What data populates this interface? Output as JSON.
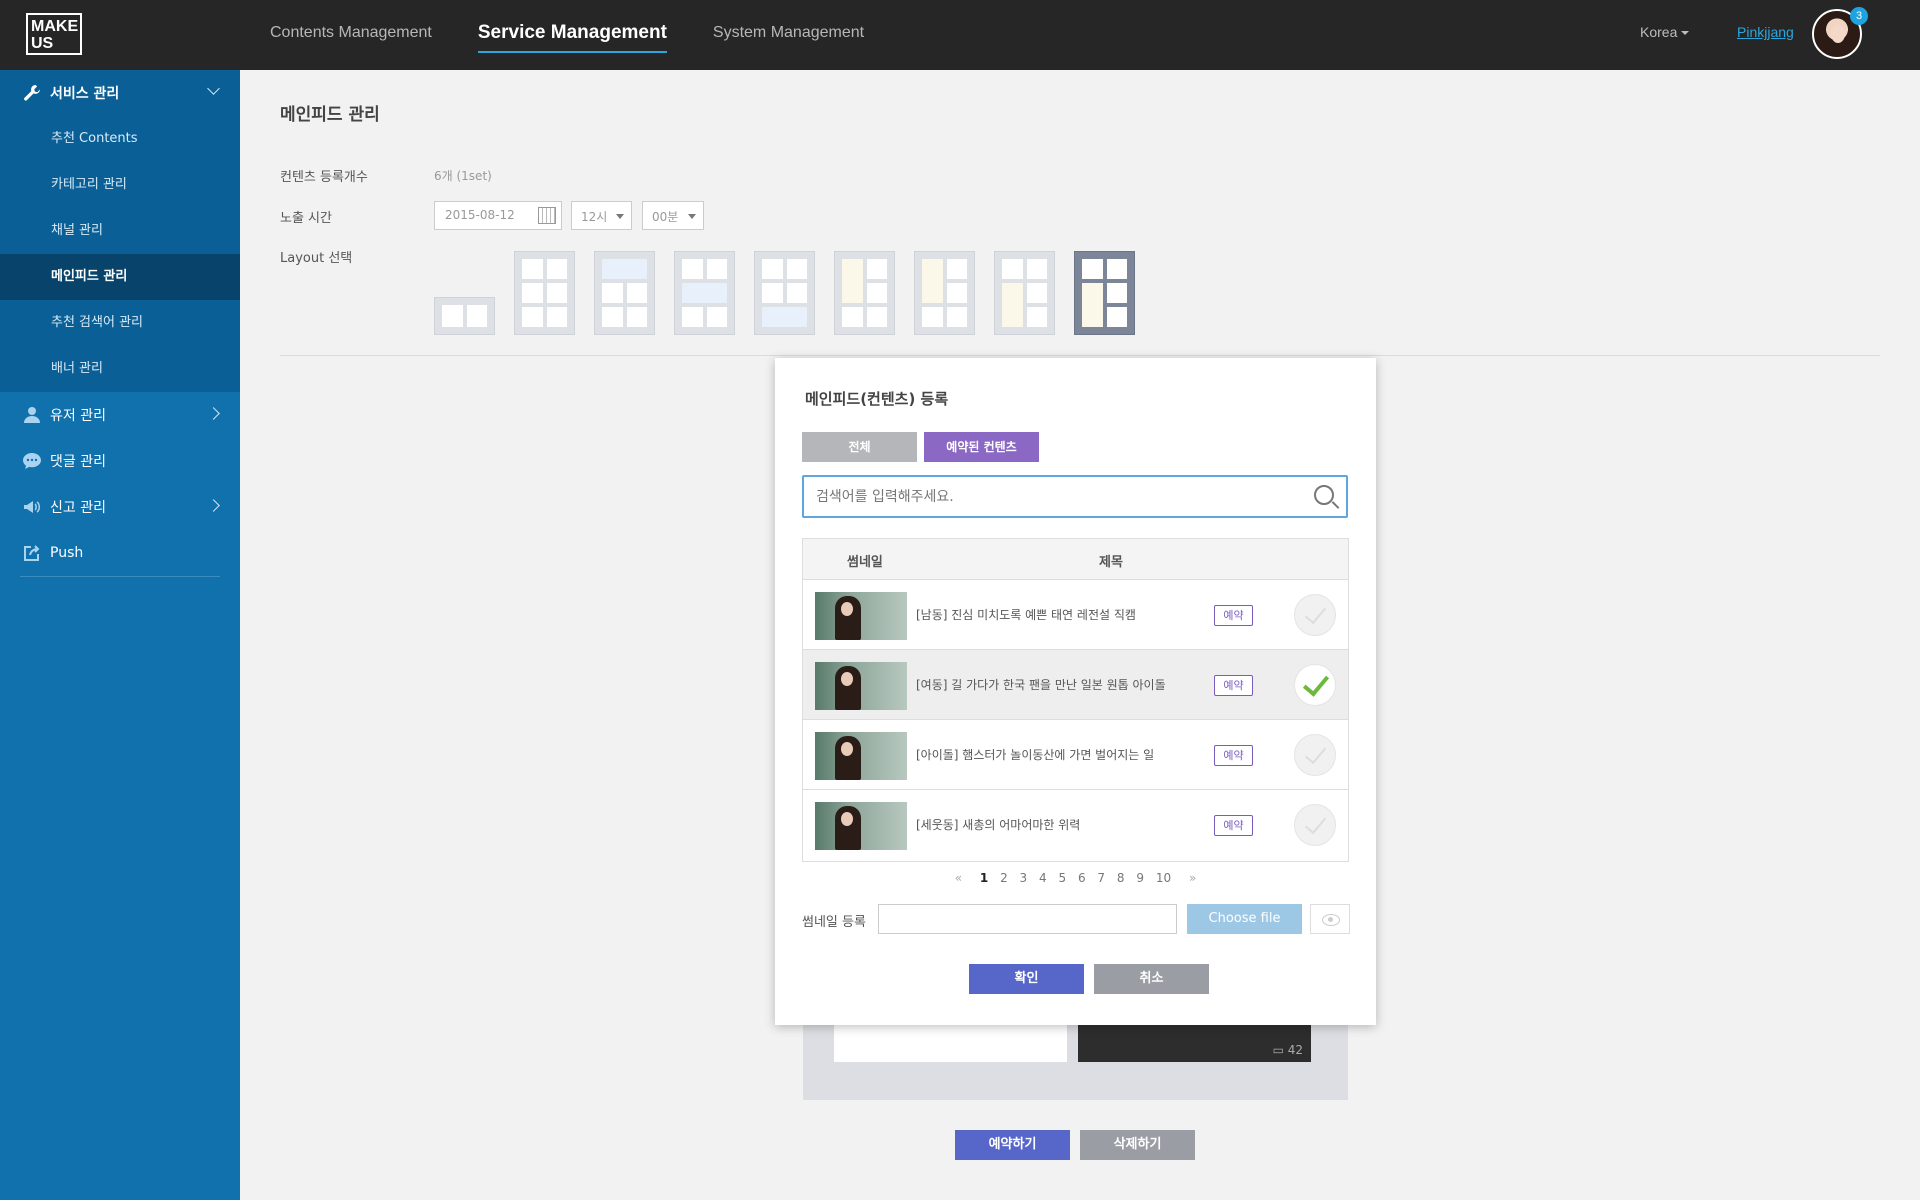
{
  "logo": {
    "line1": "MAKE",
    "line2": "US"
  },
  "topnav": {
    "items": [
      {
        "label": "Contents Management"
      },
      {
        "label": "Service Management"
      },
      {
        "label": "System Management"
      }
    ],
    "region": "Korea",
    "username": "Pinkjjang",
    "notification_count": "3"
  },
  "sidebar": {
    "service": {
      "label": "서비스 관리",
      "items": [
        {
          "label": "추천 Contents"
        },
        {
          "label": "카테고리 관리"
        },
        {
          "label": "채널 관리"
        },
        {
          "label": "메인피드 관리"
        },
        {
          "label": "추천 검색어 관리"
        },
        {
          "label": "배너 관리"
        }
      ]
    },
    "user": {
      "label": "유저 관리"
    },
    "comment": {
      "label": "댓글 관리"
    },
    "report": {
      "label": "신고 관리"
    },
    "push": {
      "label": "Push"
    }
  },
  "page": {
    "title": "메인피드 관리",
    "count_label": "컨텐츠 등록개수",
    "count_value": "6개 (1set)",
    "time_label": "노출 시간",
    "date_value": "2015-08-12",
    "hour_value": "12시",
    "minute_value": "00분",
    "layout_label": "Layout 선택",
    "bg_card_count": "42",
    "reserve_button": "예약하기",
    "delete_button": "삭제하기"
  },
  "modal": {
    "title": "메인피드(컨텐츠) 등록",
    "tab_all": "전체",
    "tab_reserved": "예약된 컨텐츠",
    "search_placeholder": "검색어를 입력해주세요.",
    "col_thumbnail": "썸네일",
    "col_title": "제목",
    "rows": [
      {
        "title": "[남동] 진심 미치도록 예쁜 태연 레전설 직캠",
        "tag": "예약",
        "checked": false
      },
      {
        "title": "[여동] 길 가다가 한국 팬을 만난 일본 원톱 아이돌",
        "tag": "예약",
        "checked": true
      },
      {
        "title": "[아이돌] 햄스터가 놀이동산에 가면 벌어지는 일",
        "tag": "예약",
        "checked": false
      },
      {
        "title": "[세웃동] 새총의 어마어마한 위력",
        "tag": "예약",
        "checked": false
      }
    ],
    "pager": {
      "prev": "«",
      "next": "»",
      "pages": [
        "1",
        "2",
        "3",
        "4",
        "5",
        "6",
        "7",
        "8",
        "9",
        "10"
      ],
      "current": "1"
    },
    "thumb_label": "썸네일 등록",
    "choose_file": "Choose file",
    "confirm": "확인",
    "cancel": "취소"
  },
  "colors": {
    "topbar": "#262626",
    "sidebar": "#1071ad",
    "accent_blue": "#2aa8dd",
    "primary_button": "#5767c9",
    "purple_tab": "#8a68c4",
    "gray_button": "#9a9ea4",
    "check_green": "#6cb93d"
  }
}
